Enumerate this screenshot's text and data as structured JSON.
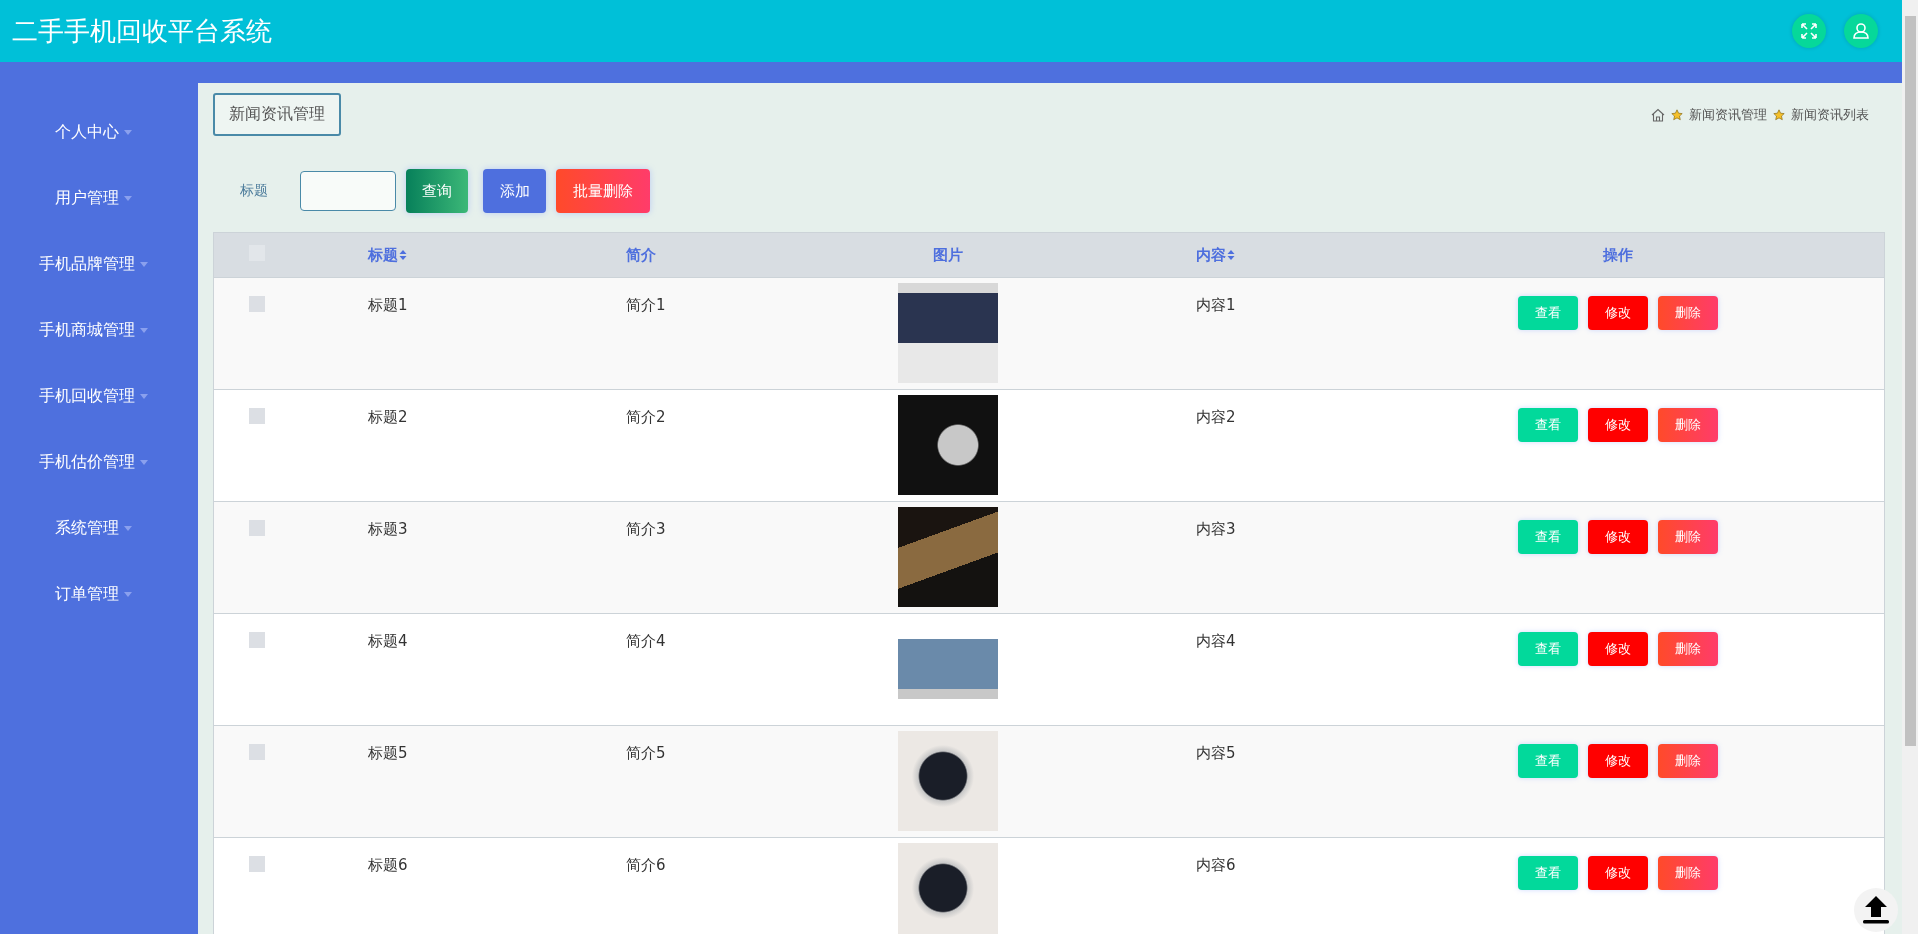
{
  "header": {
    "title": "二手手机回收平台系统"
  },
  "sidebar": {
    "items": [
      {
        "label": "个人中心"
      },
      {
        "label": "用户管理"
      },
      {
        "label": "手机品牌管理"
      },
      {
        "label": "手机商城管理"
      },
      {
        "label": "手机回收管理"
      },
      {
        "label": "手机估价管理"
      },
      {
        "label": "系统管理"
      },
      {
        "label": "订单管理"
      }
    ]
  },
  "page_tag": "新闻资讯管理",
  "breadcrumb": [
    "新闻资讯管理",
    "新闻资讯列表"
  ],
  "search": {
    "label": "标题",
    "buttons": [
      {
        "label": "查询",
        "kind": "query"
      },
      {
        "label": "添加",
        "kind": "add"
      },
      {
        "label": "批量删除",
        "kind": "delete"
      }
    ]
  },
  "table": {
    "select_all": {
      "checked": false
    },
    "columns": [
      {
        "label": "标题",
        "sortable": true
      },
      {
        "label": "简介",
        "sortable": false
      },
      {
        "label": "图片",
        "sortable": false
      },
      {
        "label": "内容",
        "sortable": true
      },
      {
        "label": "操作",
        "sortable": false
      }
    ],
    "rows": [
      {
        "checked": false,
        "title": "标题1",
        "intro": "简介1",
        "content": "内容1",
        "actions": [
          "查看",
          "修改",
          "删除"
        ]
      },
      {
        "checked": false,
        "title": "标题2",
        "intro": "简介2",
        "content": "内容2",
        "actions": [
          "查看",
          "修改",
          "删除"
        ]
      },
      {
        "checked": false,
        "title": "标题3",
        "intro": "简介3",
        "content": "内容3",
        "actions": [
          "查看",
          "修改",
          "删除"
        ]
      },
      {
        "checked": false,
        "title": "标题4",
        "intro": "简介4",
        "content": "内容4",
        "actions": [
          "查看",
          "修改",
          "删除"
        ]
      },
      {
        "checked": false,
        "title": "标题5",
        "intro": "简介5",
        "content": "内容5",
        "actions": [
          "查看",
          "修改",
          "删除"
        ]
      },
      {
        "checked": false,
        "title": "标题6",
        "intro": "简介6",
        "content": "内容6",
        "actions": [
          "查看",
          "修改",
          "删除"
        ]
      }
    ]
  }
}
